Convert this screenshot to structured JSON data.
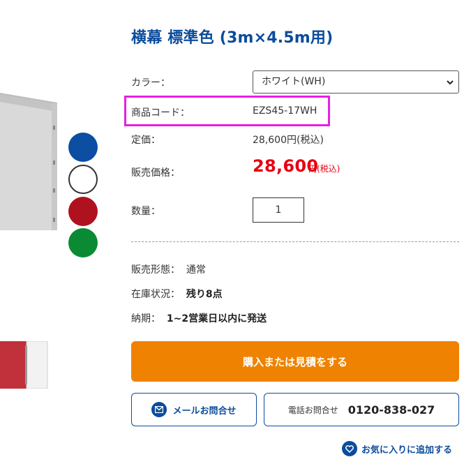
{
  "product": {
    "title": "横幕 標準色 (3m×4.5m用)",
    "color_label": "カラー：",
    "color_selected": "ホワイト(WH)",
    "code_label": "商品コード：",
    "code_value": "EZS45-17WH",
    "list_price_label": "定価：",
    "list_price_value": "28,600円(税込)",
    "sale_price_label": "販売価格：",
    "sale_price_value": "28,600",
    "sale_price_suffix": "円(税込)",
    "quantity_label": "数量：",
    "quantity_value": "1"
  },
  "details": {
    "form_label": "販売形態：",
    "form_value": "通常",
    "stock_label": "在庫状況：",
    "stock_value": "残り8点",
    "delivery_label": "納期：",
    "delivery_value": "1~2営業日以内に発送"
  },
  "actions": {
    "buy_label": "購入または見積をする",
    "mail_label": "メールお問合せ",
    "tel_label": "電話お問合せ",
    "tel_number": "0120-838-027",
    "favorite_label": "お気に入りに追加する"
  },
  "swatches": [
    {
      "name": "blue",
      "color": "#0b4ea2"
    },
    {
      "name": "white",
      "color": "#ffffff"
    },
    {
      "name": "red",
      "color": "#b0111f"
    },
    {
      "name": "green",
      "color": "#0a8a32"
    }
  ],
  "colors": {
    "brand_blue": "#0b4c9c",
    "price_red": "#e60012",
    "buy_orange": "#ef8200",
    "highlight_magenta": "#e61fe6"
  },
  "icons": [
    "chevron-down-icon",
    "mail-icon",
    "heart-icon"
  ]
}
